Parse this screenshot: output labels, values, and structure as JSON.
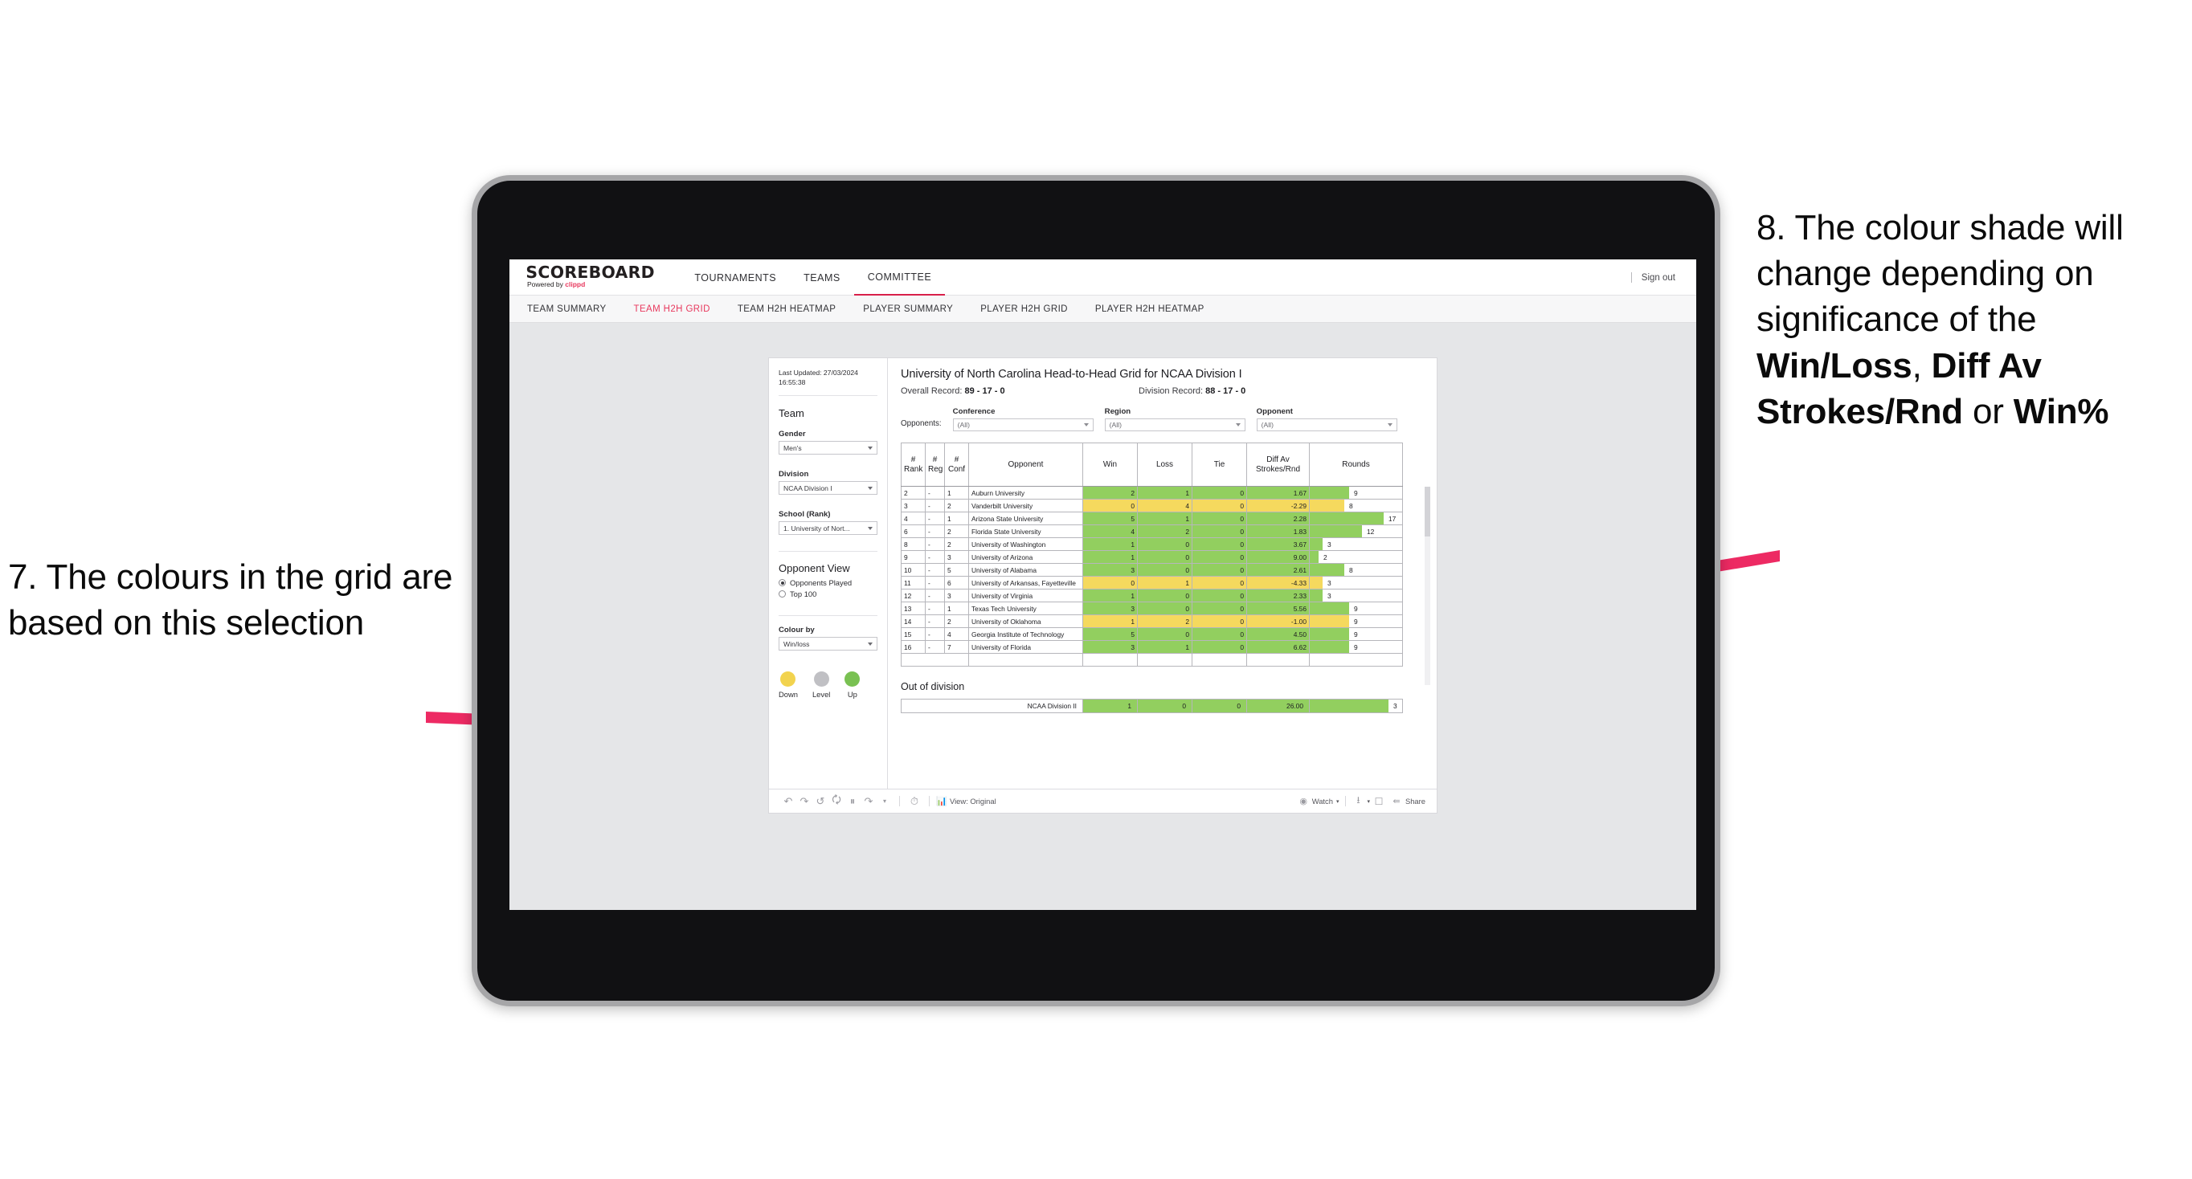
{
  "annotations": {
    "left": {
      "id": "7.",
      "text": "7. The colours in the grid are based on this selection"
    },
    "right": {
      "pre": "8. The colour shade will change depending on significance of the ",
      "bold1": "Win/Loss",
      "mid1": ", ",
      "bold2": "Diff Av Strokes/Rnd",
      "mid2": " or ",
      "bold3": "Win%"
    },
    "accent_color": "#ed2a63"
  },
  "app": {
    "logo": {
      "title": "SCOREBOARD",
      "powered_prefix": "Powered by ",
      "brand": "clippd"
    },
    "nav": [
      {
        "label": "TOURNAMENTS",
        "active": false
      },
      {
        "label": "TEAMS",
        "active": false
      },
      {
        "label": "COMMITTEE",
        "active": true
      }
    ],
    "signout": "Sign out",
    "subnav": [
      {
        "label": "TEAM SUMMARY",
        "active": false
      },
      {
        "label": "TEAM H2H GRID",
        "active": true
      },
      {
        "label": "TEAM H2H HEATMAP",
        "active": false
      },
      {
        "label": "PLAYER SUMMARY",
        "active": false
      },
      {
        "label": "PLAYER H2H GRID",
        "active": false
      },
      {
        "label": "PLAYER H2H HEATMAP",
        "active": false
      }
    ]
  },
  "sidebar": {
    "last_updated_line1": "Last Updated: 27/03/2024",
    "last_updated_line2": "16:55:38",
    "team_heading": "Team",
    "gender_label": "Gender",
    "gender_value": "Men's",
    "division_label": "Division",
    "division_value": "NCAA Division I",
    "school_label": "School (Rank)",
    "school_value": "1. University of Nort...",
    "opponent_view_heading": "Opponent View",
    "opponent_view_options": [
      {
        "label": "Opponents Played",
        "selected": true
      },
      {
        "label": "Top 100",
        "selected": false
      }
    ],
    "colour_by_label": "Colour by",
    "colour_by_value": "Win/loss",
    "legend": [
      {
        "label": "Down",
        "color": "#f2d34e"
      },
      {
        "label": "Level",
        "color": "#c0c0c4"
      },
      {
        "label": "Up",
        "color": "#79c152"
      }
    ]
  },
  "main": {
    "title": "University of North Carolina Head-to-Head Grid for NCAA Division I",
    "overall_record_label": "Overall Record: ",
    "overall_record_value": "89 - 17 - 0",
    "division_record_label": "Division Record: ",
    "division_record_value": "88 - 17 - 0",
    "opponents_label": "Opponents:",
    "filters": [
      {
        "label": "Conference",
        "value": "(All)"
      },
      {
        "label": "Region",
        "value": "(All)"
      },
      {
        "label": "Opponent",
        "value": "(All)"
      }
    ],
    "out_of_division_title": "Out of division"
  },
  "chart_data": {
    "type": "table",
    "title": "University of North Carolina Head-to-Head Grid for NCAA Division I",
    "columns": [
      {
        "key": "rank",
        "line1": "#",
        "line2": "Rank"
      },
      {
        "key": "reg",
        "line1": "#",
        "line2": "Reg"
      },
      {
        "key": "conf",
        "line1": "#",
        "line2": "Conf"
      },
      {
        "key": "opponent",
        "line1": "",
        "line2": "Opponent"
      },
      {
        "key": "win",
        "line1": "Win",
        "line2": ""
      },
      {
        "key": "loss",
        "line1": "Loss",
        "line2": ""
      },
      {
        "key": "tie",
        "line1": "Tie",
        "line2": ""
      },
      {
        "key": "diff",
        "line1": "Diff Av",
        "line2": "Strokes/Rnd"
      },
      {
        "key": "rounds",
        "line1": "Rounds",
        "line2": ""
      }
    ],
    "colour_scheme": {
      "up": "#92cf5f",
      "down": "#f5d95e",
      "level": "#c0c0c4"
    },
    "rows": [
      {
        "rank": "2",
        "reg": "-",
        "conf": "1",
        "opponent": "Auburn University",
        "win": "2",
        "loss": "1",
        "tie": "0",
        "diff": "1.67",
        "rounds": 9,
        "state": "up"
      },
      {
        "rank": "3",
        "reg": "-",
        "conf": "2",
        "opponent": "Vanderbilt University",
        "win": "0",
        "loss": "4",
        "tie": "0",
        "diff": "-2.29",
        "rounds": 8,
        "state": "down"
      },
      {
        "rank": "4",
        "reg": "-",
        "conf": "1",
        "opponent": "Arizona State University",
        "win": "5",
        "loss": "1",
        "tie": "0",
        "diff": "2.28",
        "rounds": 17,
        "state": "up"
      },
      {
        "rank": "6",
        "reg": "-",
        "conf": "2",
        "opponent": "Florida State University",
        "win": "4",
        "loss": "2",
        "tie": "0",
        "diff": "1.83",
        "rounds": 12,
        "state": "up"
      },
      {
        "rank": "8",
        "reg": "-",
        "conf": "2",
        "opponent": "University of Washington",
        "win": "1",
        "loss": "0",
        "tie": "0",
        "diff": "3.67",
        "rounds": 3,
        "state": "up"
      },
      {
        "rank": "9",
        "reg": "-",
        "conf": "3",
        "opponent": "University of Arizona",
        "win": "1",
        "loss": "0",
        "tie": "0",
        "diff": "9.00",
        "rounds": 2,
        "state": "up"
      },
      {
        "rank": "10",
        "reg": "-",
        "conf": "5",
        "opponent": "University of Alabama",
        "win": "3",
        "loss": "0",
        "tie": "0",
        "diff": "2.61",
        "rounds": 8,
        "state": "up"
      },
      {
        "rank": "11",
        "reg": "-",
        "conf": "6",
        "opponent": "University of Arkansas, Fayetteville",
        "win": "0",
        "loss": "1",
        "tie": "0",
        "diff": "-4.33",
        "rounds": 3,
        "state": "down"
      },
      {
        "rank": "12",
        "reg": "-",
        "conf": "3",
        "opponent": "University of Virginia",
        "win": "1",
        "loss": "0",
        "tie": "0",
        "diff": "2.33",
        "rounds": 3,
        "state": "up"
      },
      {
        "rank": "13",
        "reg": "-",
        "conf": "1",
        "opponent": "Texas Tech University",
        "win": "3",
        "loss": "0",
        "tie": "0",
        "diff": "5.56",
        "rounds": 9,
        "state": "up"
      },
      {
        "rank": "14",
        "reg": "-",
        "conf": "2",
        "opponent": "University of Oklahoma",
        "win": "1",
        "loss": "2",
        "tie": "0",
        "diff": "-1.00",
        "rounds": 9,
        "state": "down"
      },
      {
        "rank": "15",
        "reg": "-",
        "conf": "4",
        "opponent": "Georgia Institute of Technology",
        "win": "5",
        "loss": "0",
        "tie": "0",
        "diff": "4.50",
        "rounds": 9,
        "state": "up"
      },
      {
        "rank": "16",
        "reg": "-",
        "conf": "7",
        "opponent": "University of Florida",
        "win": "3",
        "loss": "1",
        "tie": "0",
        "diff": "6.62",
        "rounds": 9,
        "state": "up"
      }
    ],
    "out_of_division_rows": [
      {
        "opponent": "NCAA Division II",
        "win": "1",
        "loss": "0",
        "tie": "0",
        "diff": "26.00",
        "rounds": 3,
        "state": "up"
      }
    ],
    "rounds_max": 17
  },
  "toolbar": {
    "view_label": "View: Original",
    "watch_label": "Watch",
    "share_label": "Share"
  }
}
